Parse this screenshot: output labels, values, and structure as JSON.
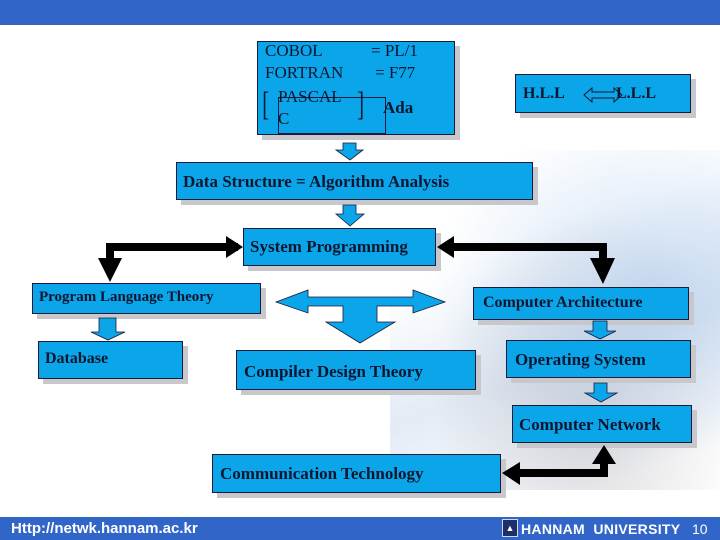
{
  "slide": {
    "page_number": "10",
    "colors": {
      "box_fill": "#0ba6ea",
      "box_text": "#0c1630",
      "bar": "#3166c8",
      "connector_black": "#000000"
    }
  },
  "language_box": {
    "line1_left": "COBOL",
    "line1_right": "= PL/1",
    "line2_left": "FORTRAN",
    "line2_right": "= F77",
    "group_item1": "PASCAL",
    "group_item2": "C",
    "group_right": "Ada"
  },
  "hll_box": {
    "left": "H.L.L",
    "right": "L.L.L",
    "arrow": "double-arrow-icon"
  },
  "nodes": {
    "data_structure": "Data Structure = Algorithm Analysis",
    "system_programming": "System Programming",
    "program_language_theory": "Program Language Theory",
    "computer_architecture": "Computer Architecture",
    "database": "Database",
    "compiler_design_theory": "Compiler Design Theory",
    "operating_system": "Operating System",
    "computer_network": "Computer Network",
    "communication_technology": "Communication Technology"
  },
  "footer": {
    "url": "Http://netwk.hannam.ac.kr",
    "university": "HANNAM  UNIVERSITY",
    "logo": "university-logo-icon",
    "page": "10"
  }
}
